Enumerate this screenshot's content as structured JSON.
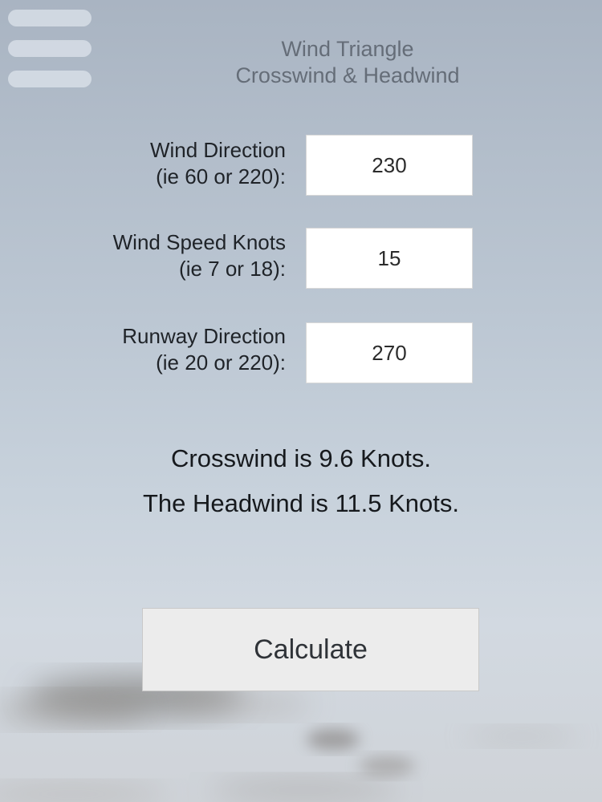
{
  "menu": {
    "icon": "hamburger-menu-icon"
  },
  "header": {
    "title_line1": "Wind Triangle",
    "title_line2": "Crosswind & Headwind"
  },
  "form": {
    "wind_direction": {
      "label_line1": "Wind Direction",
      "label_line2": "(ie 60 or 220):",
      "value": "230"
    },
    "wind_speed": {
      "label_line1": "Wind Speed Knots",
      "label_line2": "(ie 7 or 18):",
      "value": "15"
    },
    "runway_direction": {
      "label_line1": "Runway Direction",
      "label_line2": "(ie 20 or 220):",
      "value": "270"
    }
  },
  "results": {
    "crosswind": "Crosswind is 9.6 Knots.",
    "headwind": "The Headwind is 11.5 Knots."
  },
  "actions": {
    "calculate_label": "Calculate"
  },
  "colors": {
    "title_text": "#656d78",
    "body_text": "#1f2328",
    "field_bg": "#ffffff",
    "button_bg": "#ececec"
  }
}
